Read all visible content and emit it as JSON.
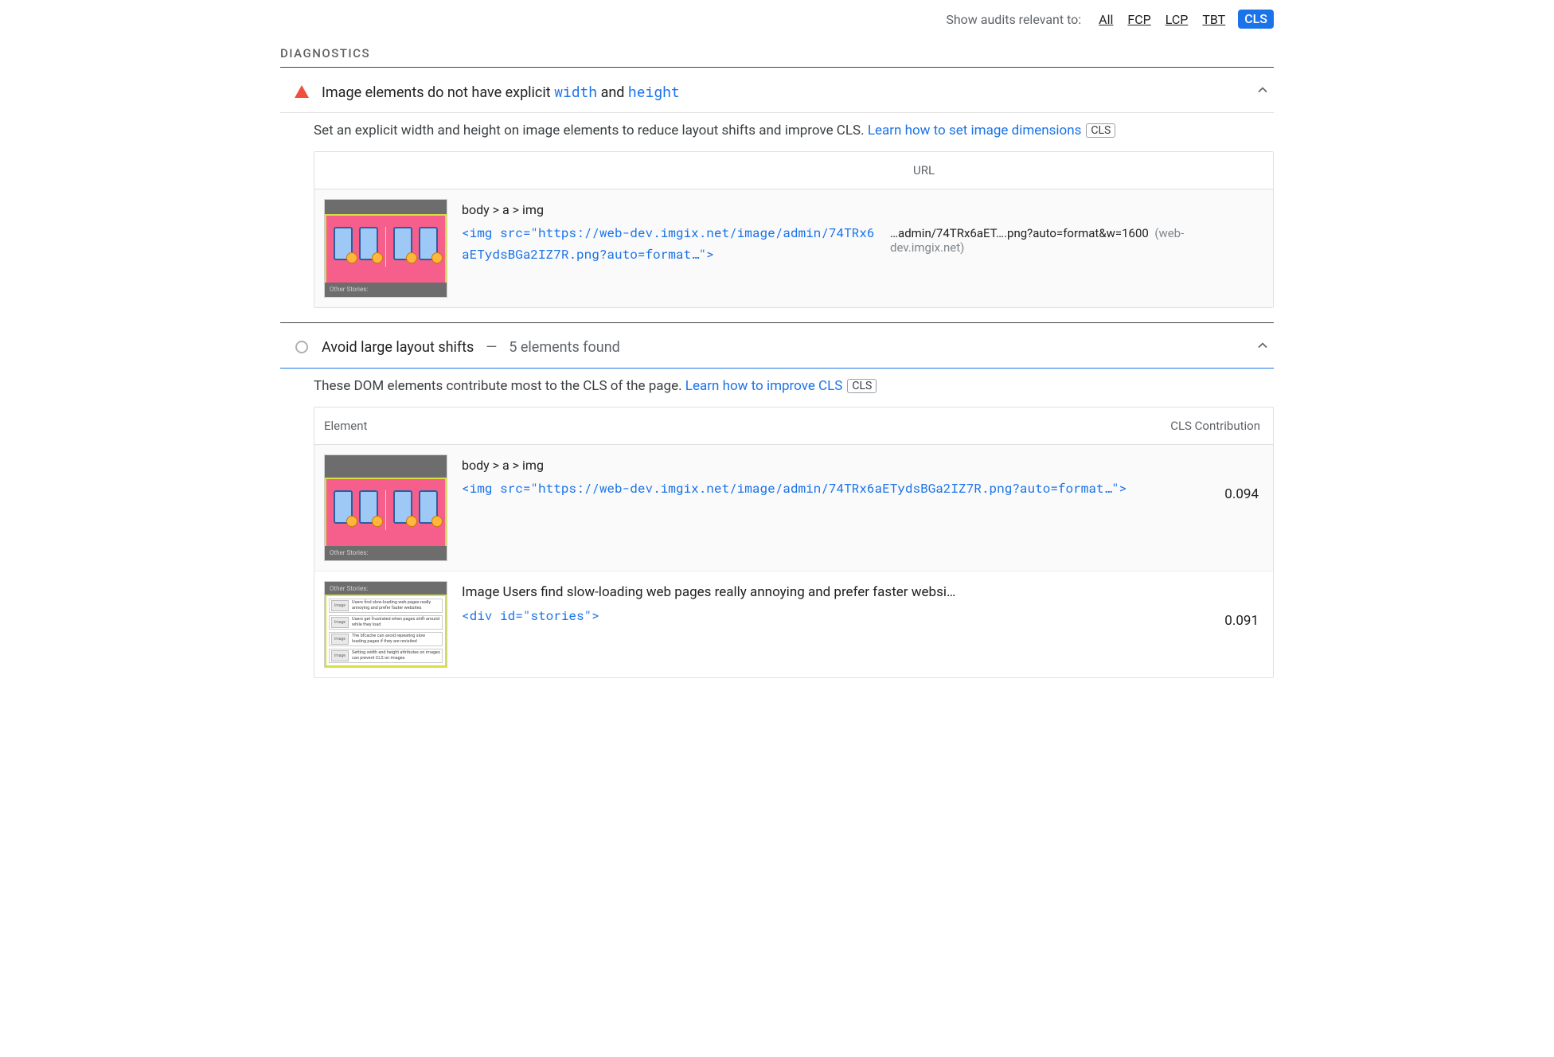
{
  "filter": {
    "label": "Show audits relevant to:",
    "items": [
      "All",
      "FCP",
      "LCP",
      "TBT"
    ],
    "active": "CLS"
  },
  "section": "DIAGNOSTICS",
  "audit1": {
    "title_pre": "Image elements do not have explicit ",
    "code1": "width",
    "mid": " and ",
    "code2": "height",
    "desc_pre": "Set an explicit width and height on image elements to reduce layout shifts and improve CLS. ",
    "desc_link": "Learn how to set image dimensions",
    "badge": "CLS",
    "th_url": "URL",
    "row": {
      "selector": "body > a > img",
      "code": "<img src=\"https://web-dev.imgix.net/image/admin/74TRx6aETydsBGa2IZ7R.png?auto=format…\">",
      "url": "…admin/74TRx6aET….png?auto=format&w=1600",
      "url_host": "(web-dev.imgix.net)",
      "thumb_band": "Other Stories:"
    }
  },
  "audit2": {
    "title": "Avoid large layout shifts",
    "dash": "—",
    "sub": "5 elements found",
    "desc_pre": "These DOM elements contribute most to the CLS of the page. ",
    "desc_link": "Learn how to improve CLS",
    "badge": "CLS",
    "th_el": "Element",
    "th_cls": "CLS Contribution",
    "row1": {
      "selector": "body > a > img",
      "code": "<img src=\"https://web-dev.imgix.net/image/admin/74TRx6aETydsBGa2IZ7R.png?auto=format…\">",
      "cls": "0.094",
      "thumb_band": "Other Stories:"
    },
    "row2": {
      "title": "Image Users find slow-loading web pages really annoying and prefer faster websi…",
      "code": "<div id=\"stories\">",
      "cls": "0.091",
      "thumb_band": "Other Stories:",
      "stories": [
        "Users find slow-loading web pages really annoying and prefer faster websites",
        "Users get frustrated when pages shift around while they load",
        "The bfcache can avoid repeating slow loading pages if they are revisited",
        "Setting width and height attributes on images can prevent CLS on images"
      ],
      "img_label": "Image"
    }
  }
}
